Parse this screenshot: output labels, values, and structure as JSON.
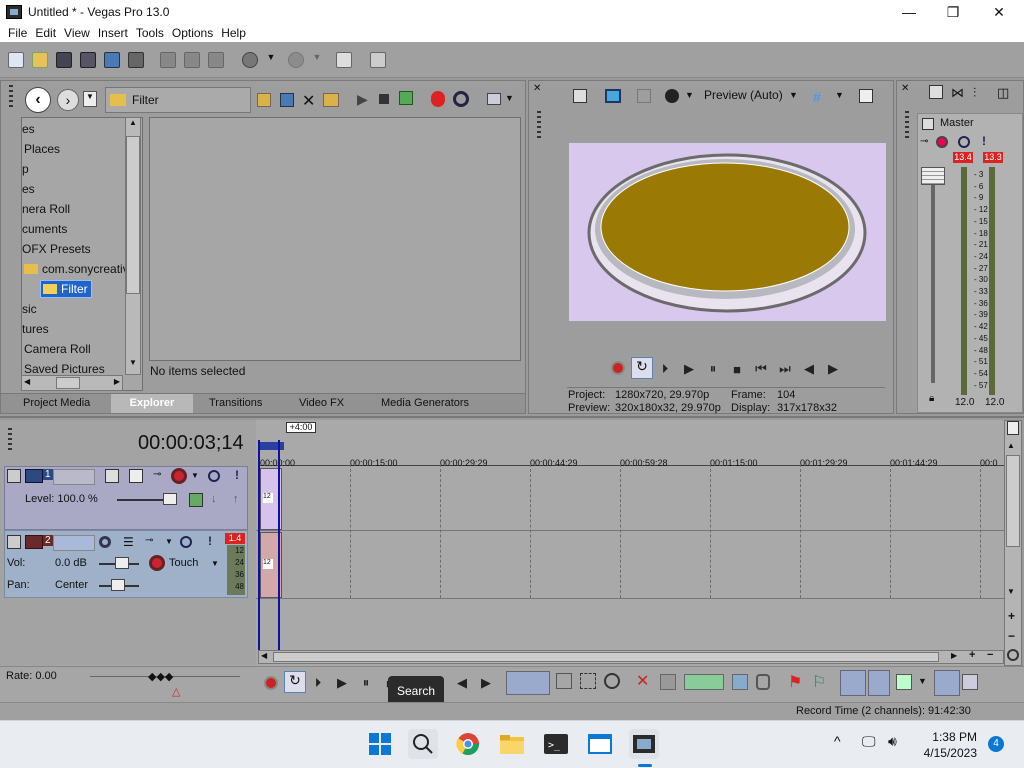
{
  "window": {
    "title": "Untitled * - Vegas Pro 13.0",
    "minimize": "—",
    "maximize": "❐",
    "close": "✕"
  },
  "menu": [
    "File",
    "Edit",
    "View",
    "Insert",
    "Tools",
    "Options",
    "Help"
  ],
  "explorer": {
    "path_label": "Filter",
    "tree": [
      "es",
      "Places",
      "p",
      "es",
      "nera Roll",
      "cuments",
      "OFX Presets",
      "com.sonycreativ",
      "Filter",
      "sic",
      "tures",
      "Camera Roll",
      "Saved Pictures"
    ],
    "status": "No items selected",
    "tabs": [
      "Project Media",
      "Explorer",
      "Transitions",
      "Video FX",
      "Media Generators"
    ],
    "active_tab": "Explorer"
  },
  "preview": {
    "mode_label": "Preview (Auto)",
    "project_label": "Project:",
    "project_value": "1280x720, 29.970p",
    "preview_label": "Preview:",
    "preview_value": "320x180x32, 29.970p",
    "frame_label": "Frame:",
    "frame_value": "104",
    "display_label": "Display:",
    "display_value": "317x178x32",
    "colors": {
      "background": "#d8c8ee",
      "disc": "#9a7a05"
    }
  },
  "mixer": {
    "title": "Master",
    "peak_left": "13.4",
    "peak_right": "13.3",
    "scale": [
      "3",
      "6",
      "9",
      "12",
      "15",
      "18",
      "21",
      "24",
      "27",
      "30",
      "33",
      "36",
      "39",
      "42",
      "45",
      "48",
      "51",
      "54",
      "57"
    ],
    "level_left": "12.0",
    "level_right": "12.0"
  },
  "timeline": {
    "timecode": "00:00:03;14",
    "marker": "+4:00",
    "ruler": [
      "00:00:00",
      "00:00:15:00",
      "00:00:29:29",
      "00:00:44:29",
      "00:00:59:28",
      "00:01:15:00",
      "00:01:29:29",
      "00:01:44:29",
      "00:0"
    ],
    "track1": {
      "number": "1",
      "level_label": "Level: 100.0 %"
    },
    "track2": {
      "number": "2",
      "peak": "1.4",
      "vol_label": "Vol:",
      "vol_value": "0.0 dB",
      "pan_label": "Pan:",
      "pan_value": "Center",
      "touch": "Touch",
      "meter_scale": [
        "12",
        "24",
        "36",
        "48"
      ]
    },
    "rate": "Rate: 0.00",
    "tooltip": "Search",
    "record_time": "Record Time (2 channels): 91:42:30"
  },
  "taskbar": {
    "time": "1:38 PM",
    "date": "4/15/2023",
    "badge": "4"
  }
}
